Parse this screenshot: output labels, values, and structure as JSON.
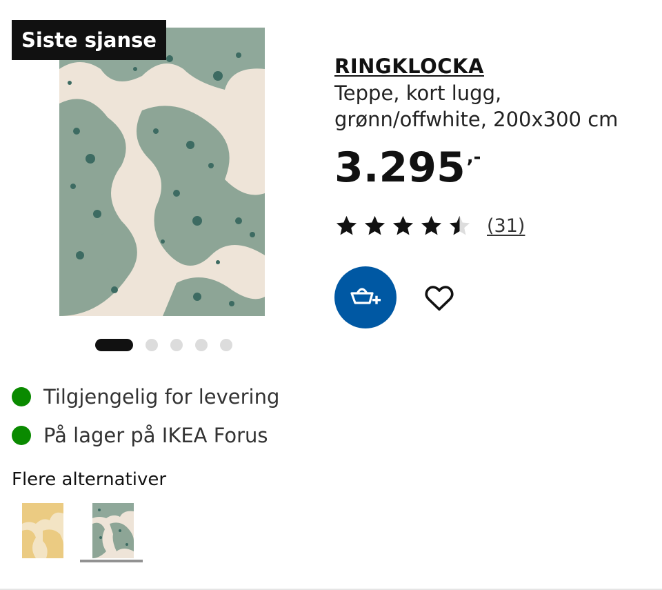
{
  "badge": {
    "label": "Siste sjanse"
  },
  "product": {
    "name": "RINGKLOCKA",
    "description": "Teppe, kort lugg, grønn/offwhite, 200x300 cm",
    "price_main": "3.295",
    "price_suffix": ",-",
    "rating": 4.5,
    "rating_max": 5,
    "review_count": "(31)"
  },
  "carousel": {
    "total": 5,
    "active_index": 0
  },
  "availability": [
    {
      "text": "Tilgjengelig for levering",
      "status_color": "#0a8a00"
    },
    {
      "text": "På lager på IKEA Forus",
      "status_color": "#0a8a00"
    }
  ],
  "alternatives": {
    "title": "Flere alternativer",
    "items": [
      {
        "colorway": "yellow/offwhite",
        "selected": false
      },
      {
        "colorway": "green/offwhite",
        "selected": true
      }
    ]
  },
  "icons": {
    "cart": "add-to-cart-icon",
    "favourite": "heart-icon",
    "star": "star-icon"
  },
  "colors": {
    "accent_blue": "#0058a3",
    "badge_bg": "#111111",
    "rug_green": "#8da596",
    "rug_dark": "#3d6b62",
    "rug_offwhite": "#efe6da",
    "rug_yellow": "#ebcb82"
  }
}
